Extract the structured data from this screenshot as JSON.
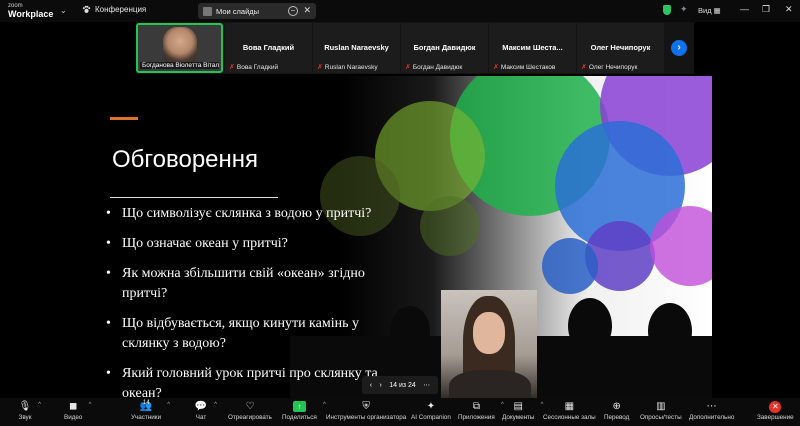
{
  "app": {
    "logo_line1": "zoom",
    "logo_line2": "Workplace",
    "conference_label": "Конференция"
  },
  "tab": {
    "label": "Мои слайды"
  },
  "titlebar": {
    "view_label": "Вид"
  },
  "participants": [
    {
      "name": "Богданова Віолетта Віталі...",
      "muted": false,
      "active": true
    },
    {
      "name": "Вова Гладкий",
      "muted": true
    },
    {
      "name": "Ruslan Naraevsky",
      "muted": true
    },
    {
      "name": "Богдан Давидюк",
      "muted": true
    },
    {
      "name": "Максим  Шеста...",
      "small": "Максим Шестаков",
      "muted": true
    },
    {
      "name": "Олег Нечипорук",
      "muted": true
    }
  ],
  "slide": {
    "title": "Обговорення",
    "bullets": [
      "Що символізує склянка з водою у притчі?",
      "Що означає океан у притчі?",
      "Як можна збільшити свій «океан» згідно притчі?",
      "Що відбувається, якщо кинути камінь у склянку з водою?",
      "Який головний урок притчі про склянку та океан?"
    ],
    "page_indicator": "14 из 24",
    "accent_color": "#e0712d"
  },
  "toolbar": {
    "participants_count": "14",
    "items": [
      {
        "label": "Звук",
        "icon": "microphone-icon"
      },
      {
        "label": "Видео",
        "icon": "video-camera-icon"
      },
      {
        "label": "Участники",
        "icon": "participants-icon"
      },
      {
        "label": "Чат",
        "icon": "chat-icon"
      },
      {
        "label": "Отреагировать",
        "icon": "heart-icon"
      },
      {
        "label": "Поделиться",
        "icon": "share-screen-icon"
      },
      {
        "label": "Инструменты организатора",
        "icon": "shield-icon"
      },
      {
        "label": "AI Companion",
        "icon": "sparkle-icon"
      },
      {
        "label": "Приложения",
        "icon": "apps-icon"
      },
      {
        "label": "Документы",
        "icon": "document-icon"
      },
      {
        "label": "Сессионные залы",
        "icon": "breakout-rooms-icon"
      },
      {
        "label": "Перевод",
        "icon": "globe-icon"
      },
      {
        "label": "Опросы/тесты",
        "icon": "poll-icon"
      },
      {
        "label": "Дополнительно",
        "icon": "more-icon"
      },
      {
        "label": "Завершение",
        "icon": "end-icon"
      }
    ]
  },
  "colors": {
    "green": "#23c552",
    "blue": "#0e72ed",
    "red": "#e5332a"
  }
}
